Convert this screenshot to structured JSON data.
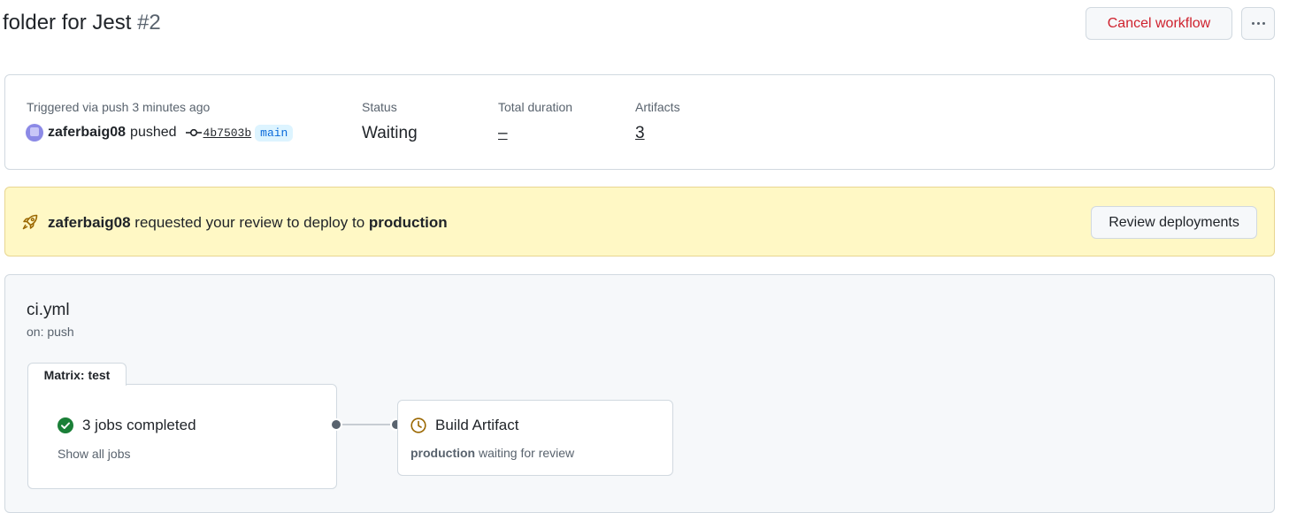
{
  "header": {
    "title": "folder for Jest",
    "run_number": "#2",
    "cancel_label": "Cancel workflow",
    "more_icon": "kebab-horizontal-icon"
  },
  "summary": {
    "trigger_label": "Triggered via push 3 minutes ago",
    "username": "zaferbaig08",
    "action": "pushed",
    "commit_sha": "4b7503b",
    "branch": "main",
    "status_label": "Status",
    "status_value": "Waiting",
    "duration_label": "Total duration",
    "duration_value": "–",
    "artifacts_label": "Artifacts",
    "artifacts_value": "3"
  },
  "review": {
    "icon": "rocket-icon",
    "username": "zaferbaig08",
    "text": "requested your review to deploy to",
    "environment": "production",
    "button_label": "Review deployments"
  },
  "workflow": {
    "file": "ci.yml",
    "trigger": "on: push",
    "matrix_label": "Matrix: test",
    "jobs_status": "3 jobs completed",
    "show_all": "Show all jobs",
    "build_job": "Build Artifact",
    "build_env": "production",
    "build_status": "waiting for review"
  },
  "colors": {
    "danger": "#cf222e",
    "success": "#1a7f37",
    "attention": "#9a6700",
    "attention_bg": "#fff8c5",
    "link_bg": "#ddf4ff"
  }
}
